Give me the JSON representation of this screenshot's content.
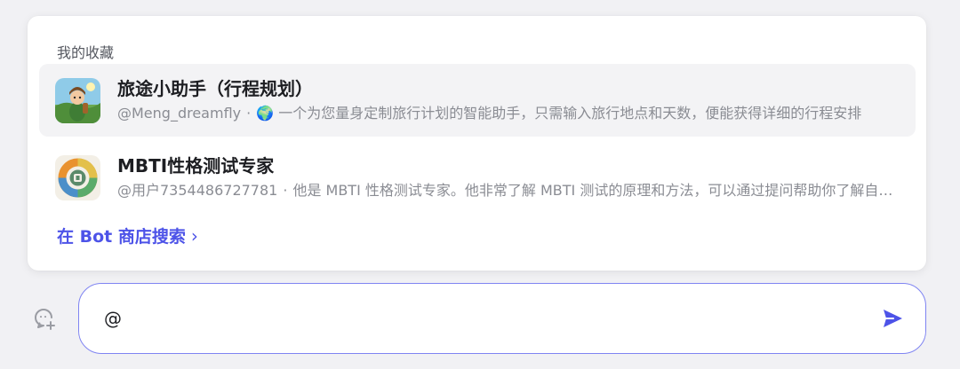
{
  "mention_popover": {
    "section_title": "我的收藏",
    "bots": [
      {
        "name": "旅途小助手（行程规划）",
        "author": "@Meng_dreamfly",
        "separator": "·",
        "description_emoji": "🌍",
        "description": "一个为您量身定制旅行计划的智能助手，只需输入旅行地点和天数，便能获得详细的行程安排",
        "avatar_icon": "cartoon-traveler-avatar"
      },
      {
        "name": "MBTI性格测试专家",
        "author": "@用户7354486727781",
        "separator": "·",
        "description": "他是 MBTI 性格测试专家。他非常了解 MBTI 测试的原理和方法，可以通过提问帮助你了解自己的性格类型",
        "avatar_icon": "mbti-wheel-avatar"
      }
    ],
    "store_search_label": "在 Bot 商店搜索",
    "store_search_chevron": "›"
  },
  "composer": {
    "input_value": "@",
    "new_chat_icon": "chat-plus-icon",
    "send_icon": "send-icon",
    "accent_color": "#4d53e8"
  }
}
